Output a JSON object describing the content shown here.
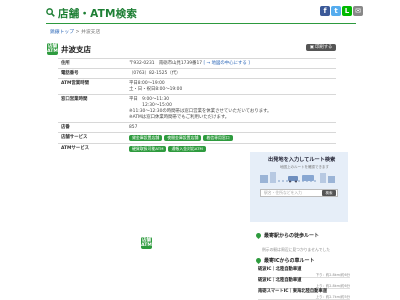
{
  "header": {
    "title": "店舗・ATM検索",
    "share": {
      "facebook": "f",
      "twitter": "t",
      "line": "L",
      "mail": "✉"
    }
  },
  "breadcrumb": {
    "home": "銚銀トップ",
    "separator": " > ",
    "current": "井波支店"
  },
  "branch": {
    "badge_line1": "店舗",
    "badge_line2": "ATM",
    "name": "井波支店",
    "print_label": "印刷する"
  },
  "info_rows": {
    "address_label": "住所",
    "address_value": "〒932-0231　南砺市山見1739番17",
    "address_link": "[ → 地図の中心にする ]",
    "phone_label": "電話番号",
    "phone_value": "（0763）82-1525（代）",
    "atm_hours_label": "ATM営業時間",
    "atm_hours_line1": "平日8:00～19:00",
    "atm_hours_line2": "土・日・祝日8:00～19:00",
    "counter_hours_label": "窓口営業時間",
    "counter_hours_line1": "平日　9:00～11:30",
    "counter_hours_line2": "　　　12:30～15:00",
    "counter_hours_note1": "※11:30～12:30の時間帯は窓口営業を休業させていただいております。",
    "counter_hours_note2": "※ATMは窓口休業時間帯でもご利用いただけます。",
    "store_no_label": "店番",
    "store_no_value": "857",
    "services_label": "店舗サービス",
    "services": [
      "貸金庫設置店舗",
      "夜間金庫設置店舗",
      "着信専用窓口"
    ],
    "atm_services_label": "ATMサービス",
    "atm_services": [
      "硬貨取扱可能ATM",
      "通帳入金対応ATM"
    ]
  },
  "route": {
    "title": "出発地を入力してルート検索",
    "subtitle": "地図上のルートを確認できます",
    "input_placeholder": "駅名・住所などを入力",
    "search_label": "検索"
  },
  "nearest_station": {
    "heading": "最寄駅からの徒歩ルート",
    "empty_note": "例示の駅は周辺に見つかりませんでした"
  },
  "nearest_ic": {
    "heading": "最寄ICからの車ルート",
    "items": [
      {
        "name": "砺波IC｜北陸自動車道",
        "dist": "下り：約2.8km/約6分"
      },
      {
        "name": "砺波IC｜北陸自動車道",
        "dist": "上り：約2.8km/約6分"
      },
      {
        "name": "南砺スマートIC｜東海北陸自動車道",
        "dist": "上り：約2.7km/約5分"
      }
    ]
  },
  "map": {
    "badge_line1": "店舗",
    "badge_line2": "ATM"
  },
  "colors": {
    "brand_green": "#2e9b3e",
    "title_green": "#1d7f34",
    "link_blue": "#2a66b8",
    "route_bg": "#e6eef8"
  }
}
